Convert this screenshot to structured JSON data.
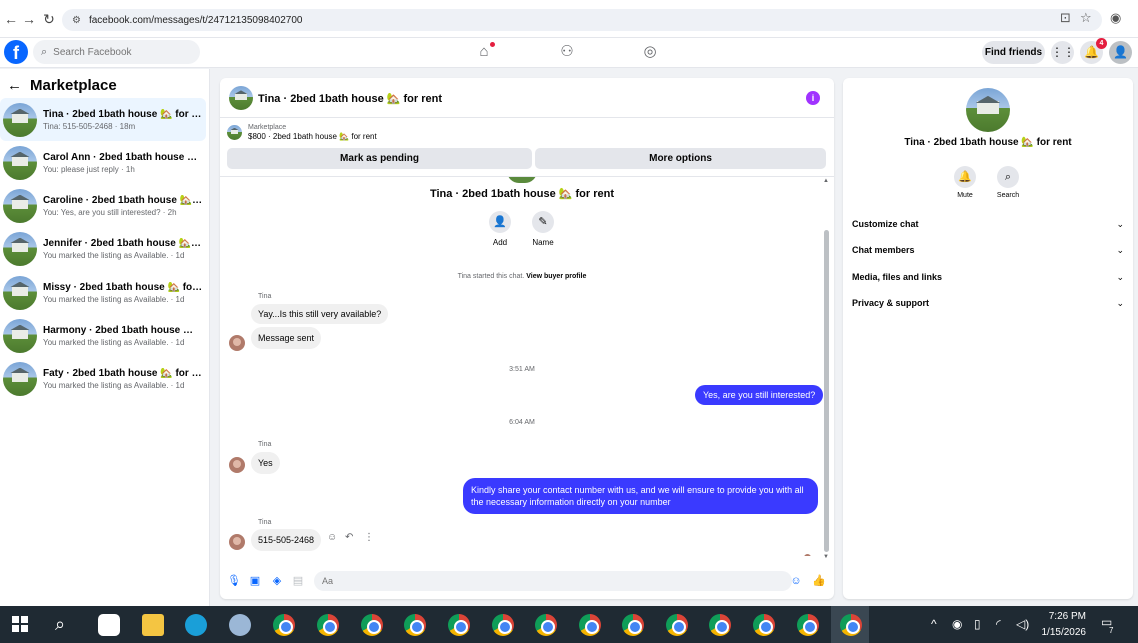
{
  "browser": {
    "url": "facebook.com/messages/t/24712135098402700"
  },
  "header": {
    "logo": "f",
    "search_placeholder": "Search Facebook",
    "find_friends": "Find friends",
    "notification_count": "4"
  },
  "sidebar": {
    "title": "Marketplace",
    "conversations": [
      {
        "name": "Tina · 2bed 1bath house 🏡 for rent",
        "preview": "Tina: 515-505-2468 · 18m"
      },
      {
        "name": "Carol Ann · 2bed 1bath house 🏡 f...",
        "preview": "You: please just reply · 1h"
      },
      {
        "name": "Caroline · 2bed 1bath house 🏡 for...",
        "preview": "You: Yes, are you still interested? · 2h"
      },
      {
        "name": "Jennifer · 2bed 1bath house 🏡 for...",
        "preview": "You marked the listing as Available. · 1d"
      },
      {
        "name": "Missy · 2bed 1bath house 🏡 for re...",
        "preview": "You marked the listing as Available. · 1d"
      },
      {
        "name": "Harmony · 2bed 1bath house 🏡 fo...",
        "preview": "You marked the listing as Available. · 1d"
      },
      {
        "name": "Faty · 2bed 1bath house 🏡 for rent",
        "preview": "You marked the listing as Available. · 1d"
      }
    ]
  },
  "chat": {
    "title": "Tina · 2bed 1bath house 🏡 for rent",
    "listing_category": "Marketplace",
    "listing_detail": "$800 · 2bed 1bath house 🏡 for rent",
    "mark_pending": "Mark as pending",
    "more_options": "More options",
    "conversation_title": "Tina · 2bed 1bath house 🏡 for rent",
    "add_label": "Add",
    "name_label": "Name",
    "system_message": "Tina started this chat.",
    "view_buyer_profile": "View buyer profile",
    "sender_name": "Tina",
    "msg1": "Yay...Is this still very available?",
    "msg2": "Message sent",
    "time1": "3:51 AM",
    "out1": "Yes, are you still interested?",
    "time2": "6:04 AM",
    "msg3": "Yes",
    "out2": "Kindly share your contact number with us, and we will ensure to provide you with all the necessary information directly on your number",
    "msg4": "515-505-2468",
    "composer_placeholder": "Aa"
  },
  "details": {
    "name": "Tina · 2bed 1bath house 🏡 for rent",
    "mute": "Mute",
    "search": "Search",
    "sections": [
      "Customize chat",
      "Chat members",
      "Media, files and links",
      "Privacy & support"
    ]
  },
  "taskbar": {
    "time": "7:26 PM",
    "date": "1/15/2026",
    "notif": "7"
  },
  "colors": {
    "brand": "#0866ff",
    "outgoing_bubble": "#3a3aff",
    "info": "#a033ff"
  }
}
